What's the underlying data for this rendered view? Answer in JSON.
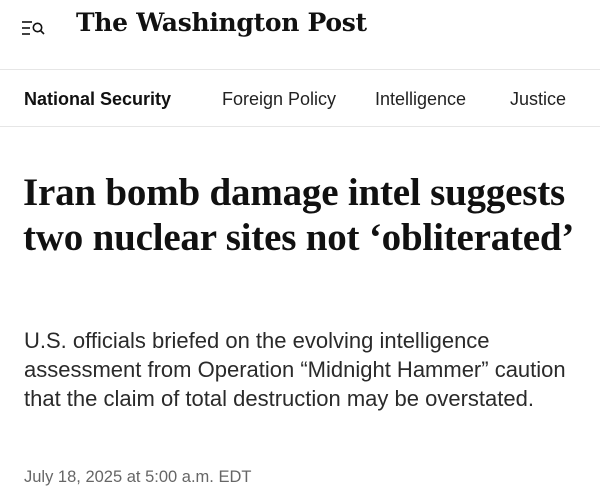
{
  "header": {
    "masthead": "The Washington Post",
    "menu_search_icon": "menu-search-icon"
  },
  "nav": {
    "items": [
      {
        "label": "National Security",
        "active": true
      },
      {
        "label": "Foreign Policy",
        "active": false
      },
      {
        "label": "Intelligence",
        "active": false
      },
      {
        "label": "Justice",
        "active": false
      }
    ]
  },
  "article": {
    "headline": "Iran bomb damage intel suggests two nuclear sites not ‘obliterated’",
    "dek": "U.S. officials briefed on the evolving intelligence assessment from Operation “Midnight Hammer” caution that the claim of total destruction may be overstated.",
    "dateline": "July 18, 2025 at 5:00 a.m. EDT"
  },
  "colors": {
    "text": "#111111",
    "muted": "#666666",
    "divider": "#e6e6e6"
  }
}
